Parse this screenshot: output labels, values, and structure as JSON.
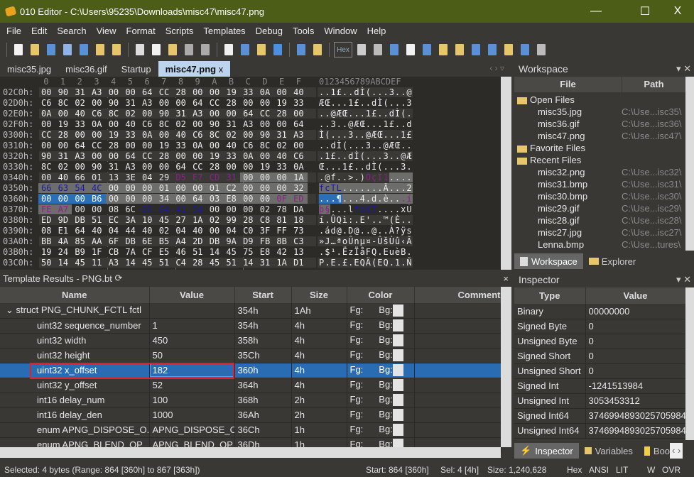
{
  "window": {
    "title": "010 Editor - C:\\Users\\95235\\Downloads\\misc47\\misc47.png",
    "minimize": "—",
    "maximize": "☐",
    "close": "X"
  },
  "menu": [
    "File",
    "Edit",
    "Search",
    "View",
    "Format",
    "Scripts",
    "Templates",
    "Debug",
    "Tools",
    "Window",
    "Help"
  ],
  "toolbar": {
    "icons": [
      {
        "name": "new-file-icon",
        "color": "#f2f2f2"
      },
      {
        "name": "open-file-icon",
        "color": "#e7c56a"
      },
      {
        "name": "save-icon",
        "color": "#5b8fd6"
      },
      {
        "name": "save-as-icon",
        "color": "#8fb3e6"
      },
      {
        "name": "save-all-icon",
        "color": "#5b8fd6"
      },
      {
        "name": "close-file-icon",
        "color": "#e7c56a"
      },
      {
        "name": "close-all-icon",
        "color": "#e7c56a"
      },
      {
        "name": "cut-icon",
        "color": "#dddddd"
      },
      {
        "name": "copy-icon",
        "color": "#f2f2f2"
      },
      {
        "name": "paste-icon",
        "color": "#e7c56a"
      },
      {
        "name": "undo-icon",
        "color": "#aaaaaa"
      },
      {
        "name": "redo-icon",
        "color": "#aaaaaa"
      },
      {
        "name": "find-icon",
        "color": "#f0f0f0"
      },
      {
        "name": "replace-icon",
        "color": "#5b8fd6"
      },
      {
        "name": "find-in-files-icon",
        "color": "#e7c56a"
      },
      {
        "name": "goto-icon",
        "color": "#4a90e2"
      },
      {
        "name": "run-script-icon",
        "color": "#5b8fd6"
      },
      {
        "name": "run-template-icon",
        "color": "#e7c56a"
      }
    ],
    "hex_label": "Hex",
    "icons2": [
      {
        "name": "wrap-icon",
        "color": "#cccccc"
      },
      {
        "name": "paragraph-icon",
        "color": "#bbbbbb"
      },
      {
        "name": "columns-icon",
        "color": "#5b8fd6"
      },
      {
        "name": "highlight-icon",
        "color": "#f2f2f2"
      },
      {
        "name": "calculator-icon",
        "color": "#5b8fd6"
      },
      {
        "name": "compare-icon",
        "color": "#e7c56a"
      },
      {
        "name": "swap-icon",
        "color": "#e7c56a"
      },
      {
        "name": "histogram-icon",
        "color": "#5b8fd6"
      },
      {
        "name": "percent-icon",
        "color": "#5b8fd6"
      },
      {
        "name": "checksum-icon",
        "color": "#e7c56a"
      },
      {
        "name": "base-convert-icon",
        "color": "#5b8fd6"
      },
      {
        "name": "pause-icon",
        "color": "#bbbbbb"
      }
    ]
  },
  "tabs": [
    {
      "label": "misc35.jpg"
    },
    {
      "label": "misc36.gif"
    },
    {
      "label": "Startup"
    },
    {
      "label": "misc47.png",
      "active": true,
      "close": "x"
    }
  ],
  "tab_nav": "‹ › ▿",
  "hex": {
    "header_cols": [
      "0",
      "1",
      "2",
      "3",
      "4",
      "5",
      "6",
      "7",
      "8",
      "9",
      "A",
      "B",
      "C",
      "D",
      "E",
      "F"
    ],
    "ascii_header": "0123456789ABCDEF",
    "rows": [
      {
        "offset": "02C0h:",
        "bytes": "00 90 31 A3 00 00 64 CC 28 00 00 19 33 0A 00 40",
        "ascii": "..1£..dÌ(...3..@"
      },
      {
        "offset": "02D0h:",
        "bytes": "C6 8C 02 00 90 31 A3 00 00 64 CC 28 00 00 19 33",
        "ascii": "ÆŒ...1£..dÌ(...3"
      },
      {
        "offset": "02E0h:",
        "bytes": "0A 00 40 C6 8C 02 00 90 31 A3 00 00 64 CC 28 00",
        "ascii": "..@ÆŒ...1£..dÌ(."
      },
      {
        "offset": "02F0h:",
        "bytes": "00 19 33 0A 00 40 C6 8C 02 00 90 31 A3 00 00 64",
        "ascii": "..3..@ÆŒ...1£..d"
      },
      {
        "offset": "0300h:",
        "bytes": "CC 28 00 00 19 33 0A 00 40 C6 8C 02 00 90 31 A3",
        "ascii": "Ì(...3..@ÆŒ...1£"
      },
      {
        "offset": "0310h:",
        "bytes": "00 00 64 CC 28 00 00 19 33 0A 00 40 C6 8C 02 00",
        "ascii": "..dÌ(...3..@ÆŒ.."
      },
      {
        "offset": "0320h:",
        "bytes": "90 31 A3 00 00 64 CC 28 00 00 19 33 0A 00 40 C6",
        "ascii": ".1£..dÌ(...3..@Æ"
      },
      {
        "offset": "0330h:",
        "bytes": "8C 02 00 90 31 A3 00 00 64 CC 28 00 00 19 33 0A",
        "ascii": "Œ...1£..dÌ(...3."
      },
      {
        "offset": "0340h:",
        "bytes": "00 40 66 01 13 3E 04 29 D5 E7 CD 31 00 00 00 1A",
        "ascii": ".@f..>.)ÕçÍ1...."
      },
      {
        "offset": "0350h:",
        "bytes": "66 63 54 4C 00 00 00 01 00 00 01 C2 00 00 00 32",
        "ascii": "fcTL.......Â...2"
      },
      {
        "offset": "0360h:",
        "bytes": "00 00 00 B6 00 00 00 34 00 64 03 E8 00 00 0F ED",
        "ascii": "...¶...4.d.è...í"
      },
      {
        "offset": "0370h:",
        "bytes": "FE A7 00 00 08 6C 66 64 41 54 00 00 00 02 78 DA",
        "ascii": "þ§...lfdAT....xÚ"
      },
      {
        "offset": "0380h:",
        "bytes": "ED 9D DB 51 EC 3A 10 45 27 1A 02 99 28 C8 81 18",
        "ascii": "í.ÛQì:.E'..™(È.."
      },
      {
        "offset": "0390h:",
        "bytes": "08 E1 64 40 04 44 40 02 04 40 00 04 C0 3F FF 73",
        "ascii": ".ád@.D@..@..À?ÿs"
      },
      {
        "offset": "03A0h:",
        "bytes": "BB 4A 85 AA 6F DB 6E B5 A4 2D DB 9A D9 FB 8B C3",
        "ascii": "»J…ªoÛnµ¤-ÛšÙû‹Ã"
      },
      {
        "offset": "03B0h:",
        "bytes": "19 24 B9 1F CB 7A CF E5 46 51 14 45 75 E8 42 13",
        "ascii": ".$¹.ËzÏåFQ.EuèB."
      },
      {
        "offset": "03C0h:",
        "bytes": "50 14 45 11 A3 14 45 51 C4 28 45 51 14 31 1A D1",
        "ascii": "P.E.£.EQÄ(EQ.1.Ñ"
      }
    ],
    "highlights": [
      {
        "row": 8,
        "from": 8,
        "to": 11,
        "fg": "#8e1f8e"
      },
      {
        "row": 8,
        "from": 12,
        "to": 15,
        "bg": "#6d6d6b"
      },
      {
        "row": 9,
        "from": 0,
        "to": 3,
        "fg": "#1c1c96",
        "bg": "#6d6d6b"
      },
      {
        "row": 9,
        "from": 4,
        "to": 15,
        "bg": "#6d6d6b"
      },
      {
        "row": 10,
        "from": 0,
        "to": 3,
        "bg": "#2c6fb5",
        "fg": "#ffffff"
      },
      {
        "row": 10,
        "from": 4,
        "to": 13,
        "bg": "#6d6d6b"
      },
      {
        "row": 10,
        "from": 14,
        "to": 15,
        "bg": "#6d6d6b",
        "fg": "#8e1f8e"
      },
      {
        "row": 11,
        "from": 0,
        "to": 1,
        "bg": "#6d6d6b",
        "fg": "#8e1f8e"
      },
      {
        "row": 11,
        "from": 6,
        "to": 9,
        "fg": "#1c1c96"
      }
    ]
  },
  "template": {
    "title": "Template Results - PNG.bt",
    "refresh_icon": "⟳",
    "close": "×",
    "columns": [
      "Name",
      "Value",
      "Start",
      "Size",
      "Color",
      "Comment"
    ],
    "rows": [
      {
        "name": "struct PNG_CHUNK_FCTL fctl",
        "value": "",
        "start": "354h",
        "size": "1Ah",
        "fg": "Fg:",
        "bg": "Bg:",
        "expanded": true
      },
      {
        "name": "uint32 sequence_number",
        "value": "1",
        "start": "354h",
        "size": "4h",
        "fg": "Fg:",
        "bg": "Bg:"
      },
      {
        "name": "uint32 width",
        "value": "450",
        "start": "358h",
        "size": "4h",
        "fg": "Fg:",
        "bg": "Bg:"
      },
      {
        "name": "uint32 height",
        "value": "50",
        "start": "35Ch",
        "size": "4h",
        "fg": "Fg:",
        "bg": "Bg:"
      },
      {
        "name": "uint32 x_offset",
        "value": "182",
        "start": "360h",
        "size": "4h",
        "fg": "Fg:",
        "bg": "Bg:",
        "selected": true
      },
      {
        "name": "uint32 y_offset",
        "value": "52",
        "start": "364h",
        "size": "4h",
        "fg": "Fg:",
        "bg": "Bg:"
      },
      {
        "name": "int16 delay_num",
        "value": "100",
        "start": "368h",
        "size": "2h",
        "fg": "Fg:",
        "bg": "Bg:"
      },
      {
        "name": "int16 delay_den",
        "value": "1000",
        "start": "36Ah",
        "size": "2h",
        "fg": "Fg:",
        "bg": "Bg:"
      },
      {
        "name": "enum APNG_DISPOSE_O...",
        "value": "APNG_DISPOSE_O...",
        "start": "36Ch",
        "size": "1h",
        "fg": "Fg:",
        "bg": "Bg:"
      },
      {
        "name": "enum APNG_BLEND_OP",
        "value": "APNG_BLEND_OP",
        "start": "36Dh",
        "size": "1h",
        "fg": "Fg:",
        "bg": "Bg:"
      }
    ]
  },
  "workspace": {
    "title": "Workspace",
    "controls": "▾ ✕",
    "columns": [
      "File",
      "Path"
    ],
    "groups": [
      {
        "label": "Open Files",
        "items": [
          {
            "file": "misc35.jpg",
            "path": "C:\\Use...isc35\\"
          },
          {
            "file": "misc36.gif",
            "path": "C:\\Use...isc36\\"
          },
          {
            "file": "misc47.png",
            "path": "C:\\Use...isc47\\"
          }
        ]
      },
      {
        "label": "Favorite Files",
        "items": []
      },
      {
        "label": "Recent Files",
        "items": [
          {
            "file": "misc32.png",
            "path": "C:\\Use...isc32\\"
          },
          {
            "file": "misc31.bmp",
            "path": "C:\\Use...isc31\\"
          },
          {
            "file": "misc30.bmp",
            "path": "C:\\Use...isc30\\"
          },
          {
            "file": "misc29.gif",
            "path": "C:\\Use...isc29\\"
          },
          {
            "file": "misc28.gif",
            "path": "C:\\Use...isc28\\"
          },
          {
            "file": "misc27.jpg",
            "path": "C:\\Use...isc27\\"
          },
          {
            "file": "Lenna.bmp",
            "path": "C:\\Use...tures\\"
          }
        ]
      }
    ],
    "tabs": [
      "Workspace",
      "Explorer"
    ]
  },
  "inspector": {
    "title": "Inspector",
    "controls": "▾ ✕",
    "columns": [
      "Type",
      "Value"
    ],
    "rows": [
      {
        "type": "Binary",
        "value": "00000000"
      },
      {
        "type": "Signed Byte",
        "value": "0"
      },
      {
        "type": "Unsigned Byte",
        "value": "0"
      },
      {
        "type": "Signed Short",
        "value": "0"
      },
      {
        "type": "Unsigned Short",
        "value": "0"
      },
      {
        "type": "Signed Int",
        "value": "-1241513984"
      },
      {
        "type": "Unsigned Int",
        "value": "3053453312"
      },
      {
        "type": "Signed Int64",
        "value": "3746994893025705984"
      },
      {
        "type": "Unsigned Int64",
        "value": "3746994893025705984"
      }
    ],
    "tabs": [
      "Inspector",
      "Variables",
      "Boo"
    ],
    "tab_nav": "‹ ›"
  },
  "status": {
    "selected": "Selected: 4 bytes (Range: 864 [360h] to 867 [363h])",
    "start": "Start: 864 [360h]",
    "sel": "Sel: 4 [4h]",
    "size": "Size: 1,240,628",
    "mode": "Hex",
    "encoding": "ANSI",
    "endian": "LIT",
    "w": "W",
    "ovr": "OVR"
  }
}
